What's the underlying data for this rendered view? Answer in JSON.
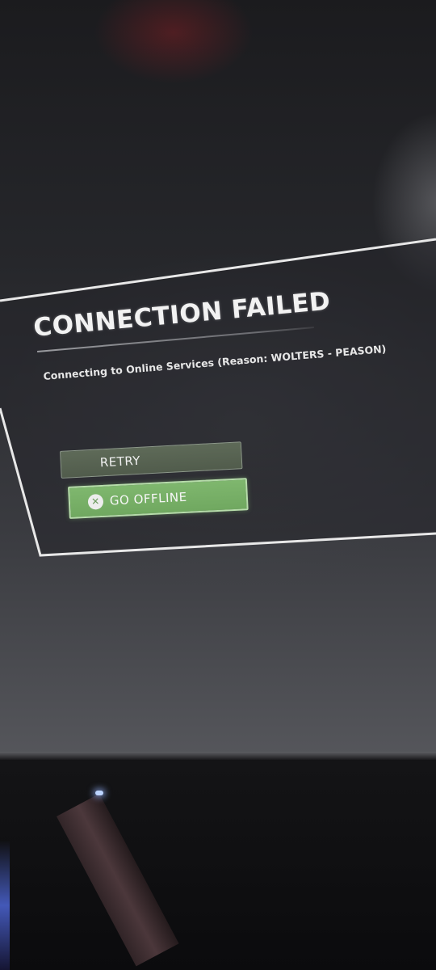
{
  "dialog": {
    "title": "CONNECTION FAILED",
    "message": "Connecting to Online Services (Reason: WOLTERS - PEASON)",
    "buttons": {
      "retry_label": "RETRY",
      "go_offline_label": "GO OFFLINE",
      "go_offline_icon": "x-button-icon"
    }
  },
  "colors": {
    "accent_green": "#7fb76e",
    "retry_button": "#5e6a58",
    "frame_border": "#e8e8e8",
    "background": "#2a2b2f"
  }
}
